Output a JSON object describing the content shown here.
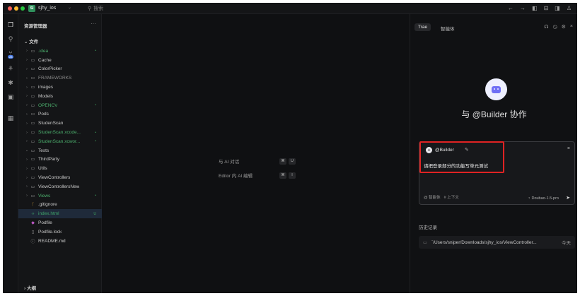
{
  "titlebar": {
    "project_badge": "SI",
    "project_name": "sjhy_ios",
    "search_label": "搜索"
  },
  "explorer": {
    "title": "资源管理器",
    "section": "文件",
    "outline": "大纲",
    "items": [
      {
        "label": ".idea",
        "icon": "folder-icon",
        "chevron": "›",
        "status": "green",
        "dot": "•"
      },
      {
        "label": "Cache",
        "icon": "folder-icon",
        "chevron": "›",
        "status": "normal",
        "dot": ""
      },
      {
        "label": "ColorPicker",
        "icon": "folder-icon",
        "chevron": "›",
        "status": "normal",
        "dot": ""
      },
      {
        "label": "FRAMEWORKS",
        "icon": "folder-icon",
        "chevron": "›",
        "status": "dim",
        "dot": ""
      },
      {
        "label": "images",
        "icon": "folder-icon",
        "chevron": "›",
        "status": "normal",
        "dot": ""
      },
      {
        "label": "Models",
        "icon": "folder-icon",
        "chevron": "›",
        "status": "normal",
        "dot": ""
      },
      {
        "label": "OPENCV",
        "icon": "folder-icon",
        "chevron": "›",
        "status": "green",
        "dot": "•"
      },
      {
        "label": "Pods",
        "icon": "folder-icon",
        "chevron": "›",
        "status": "normal",
        "dot": ""
      },
      {
        "label": "StudenScan",
        "icon": "folder-icon",
        "chevron": "›",
        "status": "normal",
        "dot": ""
      },
      {
        "label": "StudenScan.xcode...",
        "icon": "folder-icon",
        "chevron": "›",
        "status": "green",
        "dot": "•"
      },
      {
        "label": "StudenScan.xcwor...",
        "icon": "folder-icon",
        "chevron": "›",
        "status": "green",
        "dot": "•"
      },
      {
        "label": "Tests",
        "icon": "folder-icon",
        "chevron": "⌄",
        "status": "normal",
        "dot": ""
      },
      {
        "label": "ThirdParty",
        "icon": "folder-icon",
        "chevron": "›",
        "status": "normal",
        "dot": ""
      },
      {
        "label": "Utils",
        "icon": "folder-icon",
        "chevron": "›",
        "status": "normal",
        "dot": ""
      },
      {
        "label": "ViewControllers",
        "icon": "folder-icon",
        "chevron": "›",
        "status": "normal",
        "dot": ""
      },
      {
        "label": "ViewControllersNew",
        "icon": "folder-icon",
        "chevron": "›",
        "status": "normal",
        "dot": ""
      },
      {
        "label": "Views",
        "icon": "folder-icon",
        "chevron": "›",
        "status": "green",
        "dot": "•"
      },
      {
        "label": ".gitignore",
        "icon": "git-icon",
        "chevron": "",
        "status": "normal",
        "dot": ""
      },
      {
        "label": "index.html",
        "icon": "code-icon",
        "chevron": "",
        "status": "selected",
        "dot": "U"
      },
      {
        "label": "Podfile",
        "icon": "ruby-icon",
        "chevron": "",
        "status": "normal",
        "dot": ""
      },
      {
        "label": "Podfile.lock",
        "icon": "file-icon",
        "chevron": "",
        "status": "normal",
        "dot": ""
      },
      {
        "label": "README.md",
        "icon": "info-icon",
        "chevron": "",
        "status": "normal",
        "dot": ""
      }
    ]
  },
  "editor": {
    "hints": [
      {
        "label": "与 AI 对话",
        "keys": [
          "⌘",
          "U"
        ]
      },
      {
        "label": "Editor 内 AI 编辑",
        "keys": [
          "⌘",
          "I"
        ]
      }
    ]
  },
  "panel": {
    "tab_trae": "Trae",
    "tab_agent": "智能体",
    "collab_title": "与 @Builder 协作",
    "chat": {
      "mention": "@Builder",
      "avatar_text": "⊕",
      "close": "×",
      "text": "请把登录部分的功能写单元测试",
      "footer_agent": "@ 智能体",
      "footer_context": "# 上下文",
      "model": "Doubao-1.5-pro",
      "send": "➤"
    },
    "history_title": "历史记录",
    "history_item": "`/Users/sniper/Downloads/sjhy_ios/ViewController...",
    "history_date": "今天"
  },
  "colors": {
    "background": "#0f1012",
    "accent_green": "#4caf6d",
    "highlight_red": "#e02323",
    "logo_purple": "#6f6ff5"
  }
}
